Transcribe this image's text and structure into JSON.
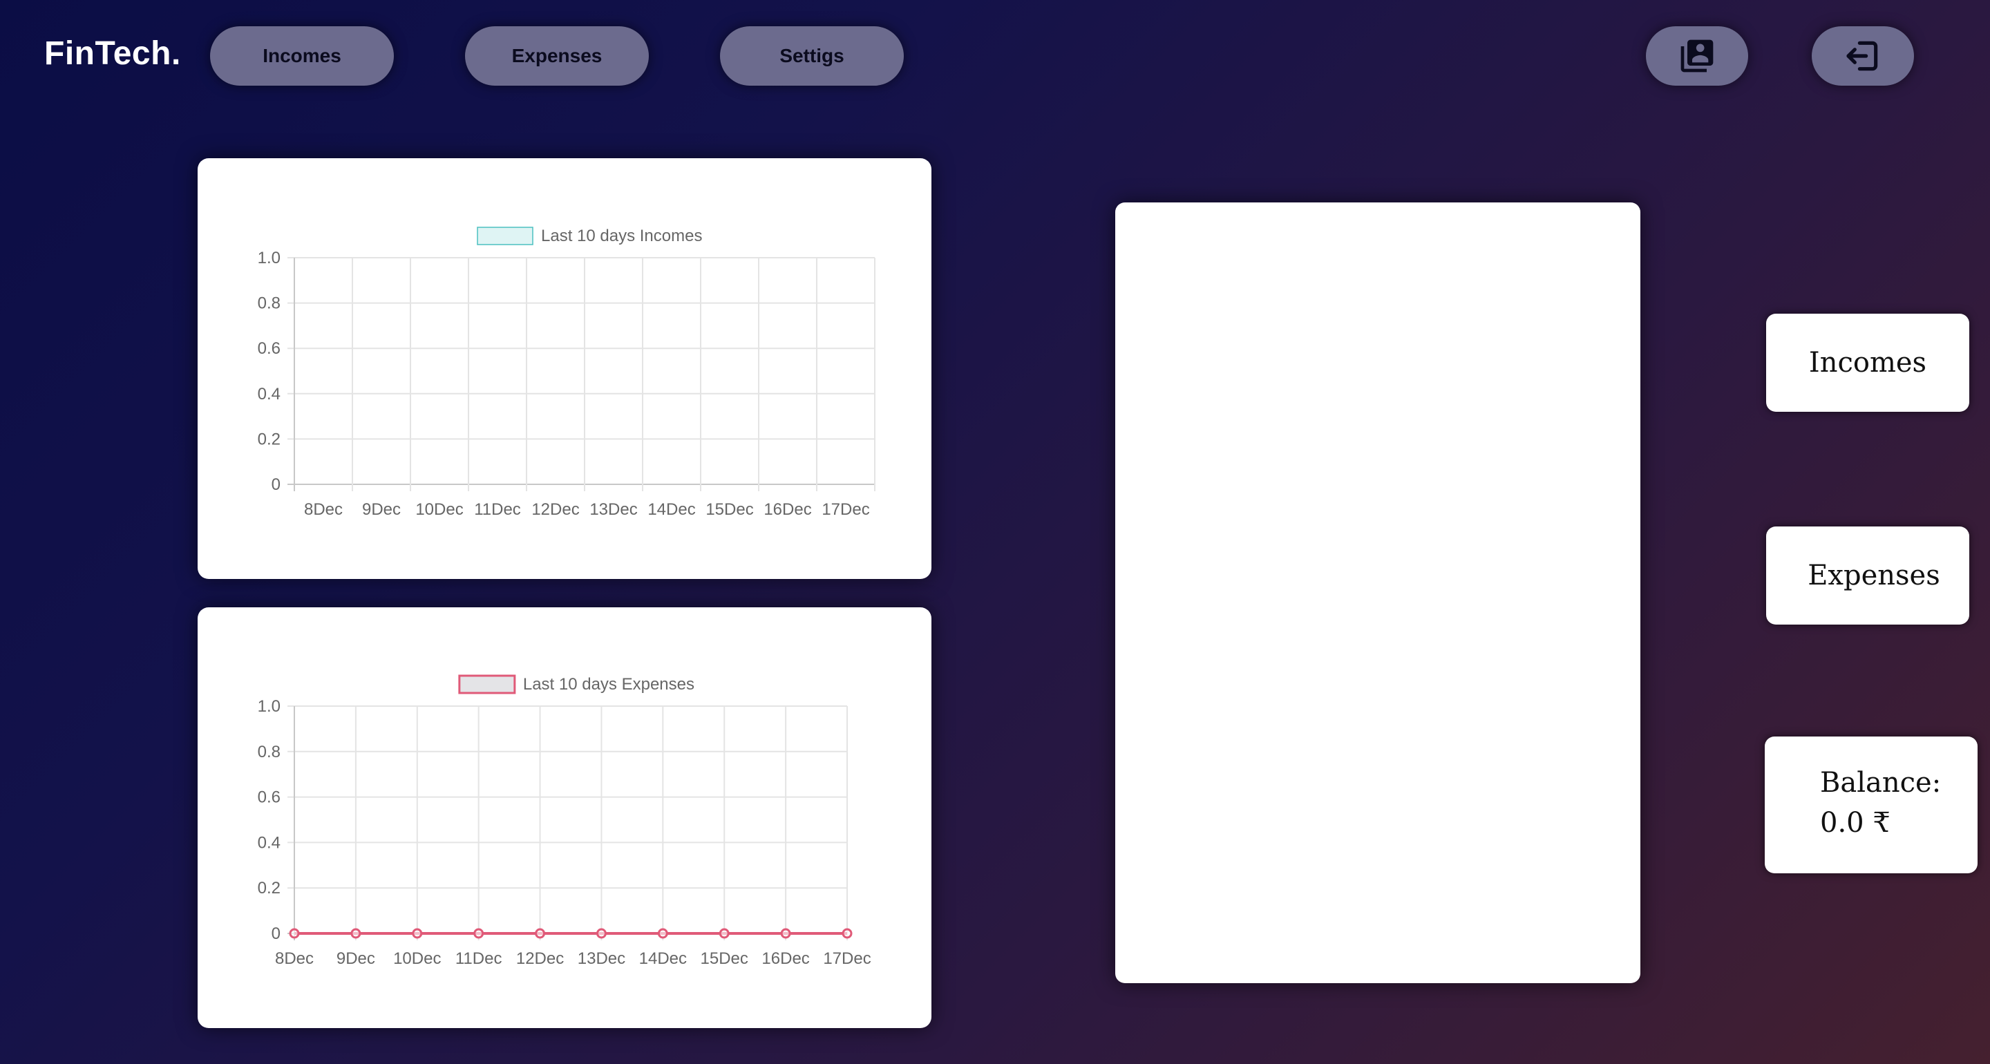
{
  "brand": {
    "logo_text": "FinTech."
  },
  "nav": {
    "incomes_label": "Incomes",
    "expenses_label": "Expenses",
    "settings_label": "Settigs",
    "profile_icon": "contacts-icon",
    "logout_icon": "logout-icon"
  },
  "side_panel": {
    "incomes_label": "Incomes",
    "expenses_label": "Expenses",
    "balance_label": "Balance:",
    "balance_value": "0.0 ₹"
  },
  "chart_data": [
    {
      "type": "bar",
      "categories": [
        "8Dec",
        "9Dec",
        "10Dec",
        "11Dec",
        "12Dec",
        "13Dec",
        "14Dec",
        "15Dec",
        "16Dec",
        "17Dec"
      ],
      "series": [
        {
          "name": "Last 10 days Incomes",
          "values": [
            0,
            0,
            0,
            0,
            0,
            0,
            0,
            0,
            0,
            0
          ]
        }
      ],
      "yticks": [
        "0",
        "0.2",
        "0.4",
        "0.6",
        "0.8",
        "1.0"
      ],
      "ylim": [
        0,
        1.0
      ],
      "grid": true,
      "legend_position": "top",
      "color": "#4bc0c0"
    },
    {
      "type": "line",
      "categories": [
        "8Dec",
        "9Dec",
        "10Dec",
        "11Dec",
        "12Dec",
        "13Dec",
        "14Dec",
        "15Dec",
        "16Dec",
        "17Dec"
      ],
      "series": [
        {
          "name": "Last 10 days Expenses",
          "values": [
            0,
            0,
            0,
            0,
            0,
            0,
            0,
            0,
            0,
            0
          ]
        }
      ],
      "yticks": [
        "0",
        "0.2",
        "0.4",
        "0.6",
        "0.8",
        "1.0"
      ],
      "ylim": [
        0,
        1.0
      ],
      "grid": true,
      "legend_position": "top",
      "color": "#e05a78"
    }
  ]
}
